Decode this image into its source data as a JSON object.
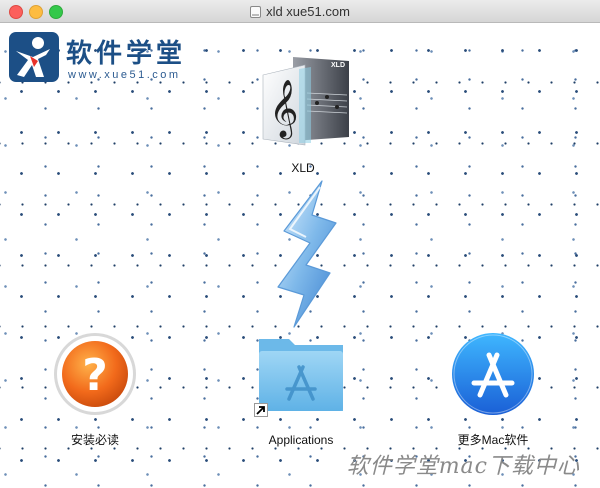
{
  "window": {
    "title": "xld xue51.com"
  },
  "logo": {
    "brand": "软件学堂",
    "url": "www.xue51.com"
  },
  "items": {
    "xld": {
      "label": "XLD"
    },
    "guide": {
      "label": "安装必读"
    },
    "applications": {
      "label": "Applications"
    },
    "more": {
      "label": "更多Mac软件"
    }
  },
  "watermark": "软件学堂mac下载中心",
  "colors": {
    "accent": "#1c4f86",
    "folder": "#7cc3ee",
    "appstore": "#1a74e8",
    "help": "#f26a1b"
  }
}
